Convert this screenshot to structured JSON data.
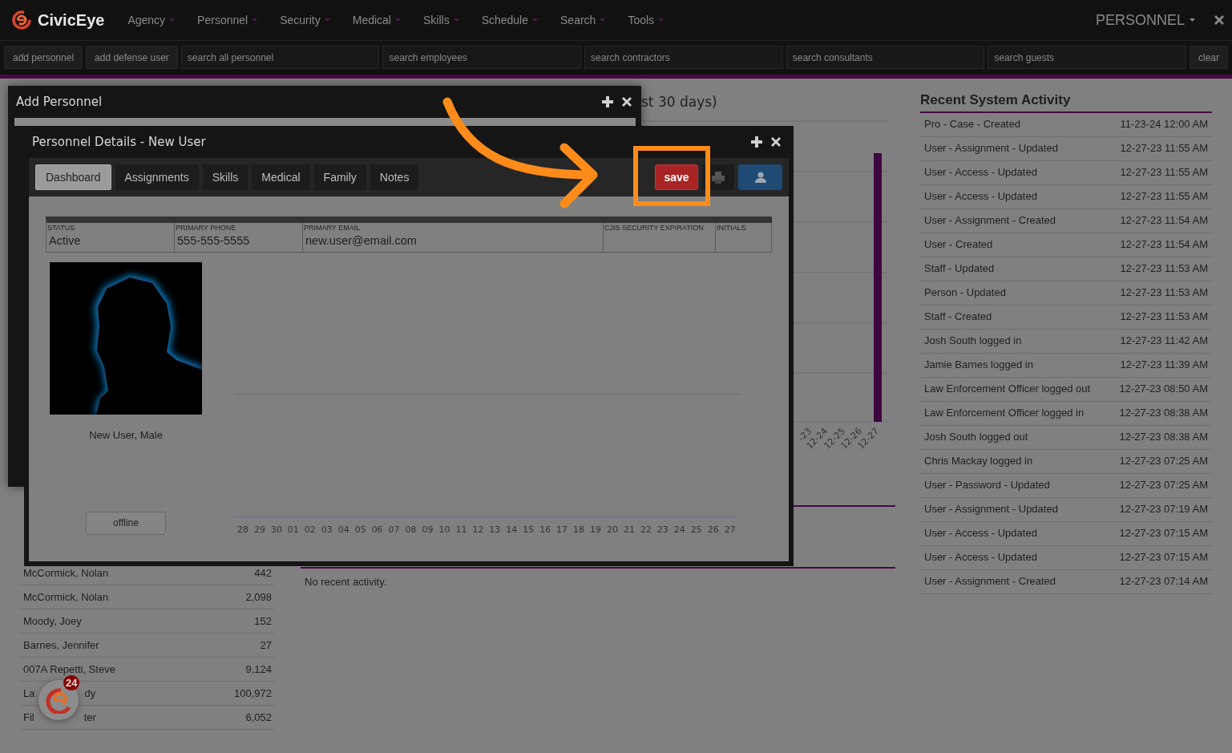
{
  "navbar": {
    "brand": "CivicEye",
    "menus": [
      {
        "label": "Agency"
      },
      {
        "label": "Personnel"
      },
      {
        "label": "Security"
      },
      {
        "label": "Medical"
      },
      {
        "label": "Skills"
      },
      {
        "label": "Schedule"
      },
      {
        "label": "Search"
      },
      {
        "label": "Tools"
      }
    ],
    "section_menu": "PERSONNEL"
  },
  "search_bar": {
    "buttons": [
      "add personnel",
      "add defense user"
    ],
    "fields": [
      {
        "placeholder": "search all personnel"
      },
      {
        "placeholder": "search employees"
      },
      {
        "placeholder": "search contractors"
      },
      {
        "placeholder": "search consultants"
      },
      {
        "placeholder": "search guests"
      }
    ],
    "clear_button": "clear"
  },
  "dashboard": {
    "person_table": {
      "rows": [
        {
          "name_parts": [
            "McCormick, Nolan"
          ],
          "value": "442"
        },
        {
          "name_parts": [
            "McCormick, Nolan"
          ],
          "value": "2,098"
        },
        {
          "name_parts": [
            "Moody, Joey"
          ],
          "value": "152"
        },
        {
          "name_parts": [
            "Barnes, Jennifer"
          ],
          "value": "27"
        },
        {
          "name_parts": [
            "007A Repetti, Steve"
          ],
          "value": "9,124"
        },
        {
          "name_parts": [
            "La",
            "dy"
          ],
          "value": "100,972"
        },
        {
          "name_parts": [
            "Fil",
            "ter"
          ],
          "value": "6,052"
        }
      ]
    },
    "chart_panel": {
      "title": "st 30 days)",
      "x_labels": [
        "-23",
        "12-24",
        "12-25",
        "12-26",
        "12-27"
      ]
    },
    "activity_panel": {
      "message": "No recent activity."
    },
    "recent_activity": {
      "title": "Recent System Activity",
      "rows": [
        {
          "event": "Pro - Case - Created",
          "time": "11-23-24 12:00 AM"
        },
        {
          "event": "User - Assignment - Updated",
          "time": "12-27-23 11:55 AM"
        },
        {
          "event": "User - Access - Updated",
          "time": "12-27-23 11:55 AM"
        },
        {
          "event": "User - Access - Updated",
          "time": "12-27-23 11:55 AM"
        },
        {
          "event": "User - Assignment - Created",
          "time": "12-27-23 11:54 AM"
        },
        {
          "event": "User - Created",
          "time": "12-27-23 11:54 AM"
        },
        {
          "event": "Staff - Updated",
          "time": "12-27-23 11:53 AM"
        },
        {
          "event": "Person - Updated",
          "time": "12-27-23 11:53 AM"
        },
        {
          "event": "Staff - Created",
          "time": "12-27-23 11:53 AM"
        },
        {
          "event": "Josh South logged in",
          "time": "12-27-23 11:42 AM"
        },
        {
          "event": "Jamie Barnes logged in",
          "time": "12-27-23 11:39 AM"
        },
        {
          "event": "Law Enforcement Officer logged out",
          "time": "12-27-23 08:50 AM"
        },
        {
          "event": "Law Enforcement Officer logged in",
          "time": "12-27-23 08:38 AM"
        },
        {
          "event": "Josh South logged out",
          "time": "12-27-23 08:38 AM"
        },
        {
          "event": "Chris Mackay logged in",
          "time": "12-27-23 07:25 AM"
        },
        {
          "event": "User - Password - Updated",
          "time": "12-27-23 07:25 AM"
        },
        {
          "event": "User - Assignment - Updated",
          "time": "12-27-23 07:19 AM"
        },
        {
          "event": "User - Access - Updated",
          "time": "12-27-23 07:15 AM"
        },
        {
          "event": "User - Access - Updated",
          "time": "12-27-23 07:15 AM"
        },
        {
          "event": "User - Assignment - Created",
          "time": "12-27-23 07:14 AM"
        }
      ]
    }
  },
  "add_personnel_window": {
    "title": "Add Personnel"
  },
  "details_window": {
    "title": "Personnel Details - New User",
    "tabs": [
      {
        "label": "Dashboard",
        "selected": true
      },
      {
        "label": "Assignments",
        "selected": false
      },
      {
        "label": "Skills",
        "selected": false
      },
      {
        "label": "Medical",
        "selected": false
      },
      {
        "label": "Family",
        "selected": false
      },
      {
        "label": "Notes",
        "selected": false
      }
    ],
    "save_button": "save",
    "info": [
      {
        "label": "STATUS",
        "value": "Active"
      },
      {
        "label": "PRIMARY PHONE",
        "value": "555-555-5555"
      },
      {
        "label": "PRIMARY EMAIL",
        "value": "new.user@email.com"
      },
      {
        "label": "CJIS SECURITY EXPIRATION"
      },
      {
        "label": "INITIALS"
      }
    ],
    "person_name": "New User, Male",
    "status_button": "offline",
    "x_labels": [
      "28",
      "29",
      "30",
      "01",
      "02",
      "03",
      "04",
      "05",
      "06",
      "07",
      "08",
      "09",
      "10",
      "11",
      "12",
      "13",
      "14",
      "15",
      "16",
      "17",
      "18",
      "19",
      "20",
      "21",
      "22",
      "23",
      "24",
      "25",
      "26",
      "27"
    ]
  },
  "notification_badge": "24"
}
